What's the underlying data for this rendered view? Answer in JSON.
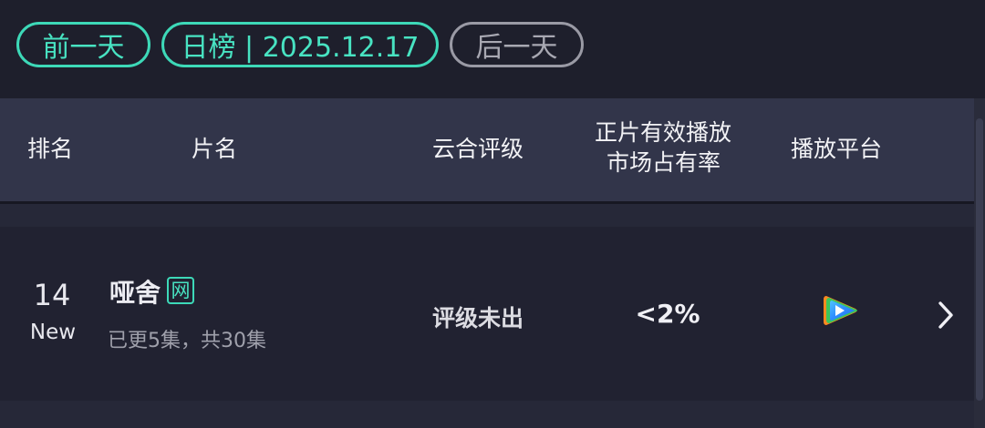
{
  "nav": {
    "prev_day": "前一天",
    "current": "日榜 | 2025.12.17",
    "next_day": "后一天"
  },
  "table_header": {
    "rank": "排名",
    "title": "片名",
    "rating": "云合评级",
    "share_line1": "正片有效播放",
    "share_line2": "市场占有率",
    "platform": "播放平台"
  },
  "rows": [
    {
      "rank": "14",
      "rank_status": "New",
      "title": "哑舍",
      "title_badge": "网",
      "episodes": "已更5集，共30集",
      "rating": "评级未出",
      "market_share": "<2%",
      "platform_icon": "tencent-video-icon"
    }
  ],
  "colors": {
    "accent": "#3dd9b8",
    "background": "#1e1f2c",
    "header_bg": "#32354a"
  }
}
